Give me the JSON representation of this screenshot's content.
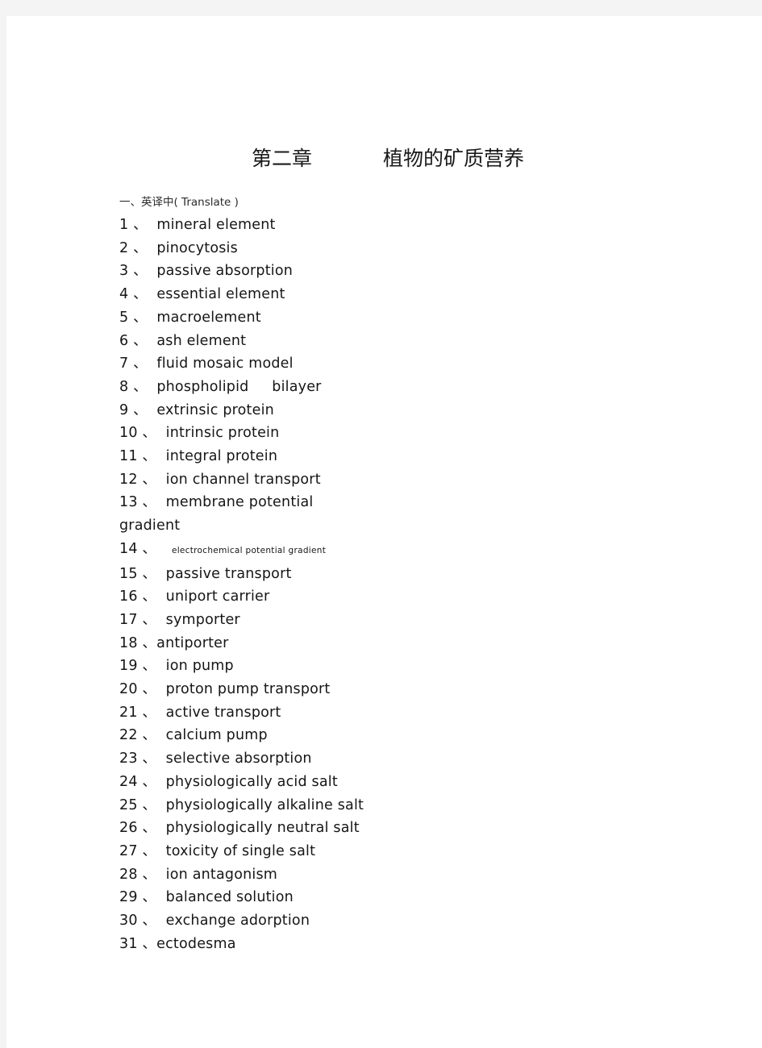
{
  "page": {
    "background_color": "#ffffff",
    "canvas_color": "#f4f4f4",
    "text_color": "#161616"
  },
  "title": {
    "chapter": "第二章",
    "subject": "植物的矿质营养"
  },
  "section": {
    "heading": "一、英译中( Translate )"
  },
  "terms": [
    {
      "number": "1 、",
      "text": "mineral element"
    },
    {
      "number": "2 、",
      "text": "pinocytosis"
    },
    {
      "number": "3 、",
      "text": "passive absorption"
    },
    {
      "number": "4 、",
      "text": "essential element"
    },
    {
      "number": "5 、",
      "text": "macroelement"
    },
    {
      "number": "6 、",
      "text": "ash element"
    },
    {
      "number": "7 、",
      "text": "fluid mosaic model"
    },
    {
      "number": "8 、",
      "text": "phospholipid     bilayer"
    },
    {
      "number": "9 、",
      "text": "extrinsic protein"
    },
    {
      "number": "10 、",
      "text": "intrinsic protein"
    },
    {
      "number": "11 、",
      "text": "integral protein"
    },
    {
      "number": "12 、",
      "text": "ion channel transport"
    },
    {
      "number": "13 、",
      "text": "membrane potential gradient"
    },
    {
      "number": "14 、",
      "text": "  electrochemical potential gradient"
    },
    {
      "number": "15 、",
      "text": "passive transport"
    },
    {
      "number": "16 、",
      "text": "uniport carrier"
    },
    {
      "number": "17 、",
      "text": "symporter"
    },
    {
      "number": "18 、",
      "text": "antiporter"
    },
    {
      "number": "19 、",
      "text": "ion pump"
    },
    {
      "number": "20 、",
      "text": "proton pump transport"
    },
    {
      "number": "21 、",
      "text": "active transport"
    },
    {
      "number": "22 、",
      "text": "calcium pump"
    },
    {
      "number": "23 、",
      "text": "selective absorption"
    },
    {
      "number": "24 、",
      "text": "physiologically acid salt"
    },
    {
      "number": "25 、",
      "text": "physiologically alkaline salt"
    },
    {
      "number": "26 、",
      "text": "physiologically neutral salt"
    },
    {
      "number": "27 、",
      "text": "toxicity of single salt"
    },
    {
      "number": "28 、",
      "text": "ion antagonism"
    },
    {
      "number": "29 、",
      "text": "balanced solution"
    },
    {
      "number": "30 、",
      "text": "exchange adorption"
    },
    {
      "number": "31 、",
      "text": "ectodesma"
    }
  ]
}
